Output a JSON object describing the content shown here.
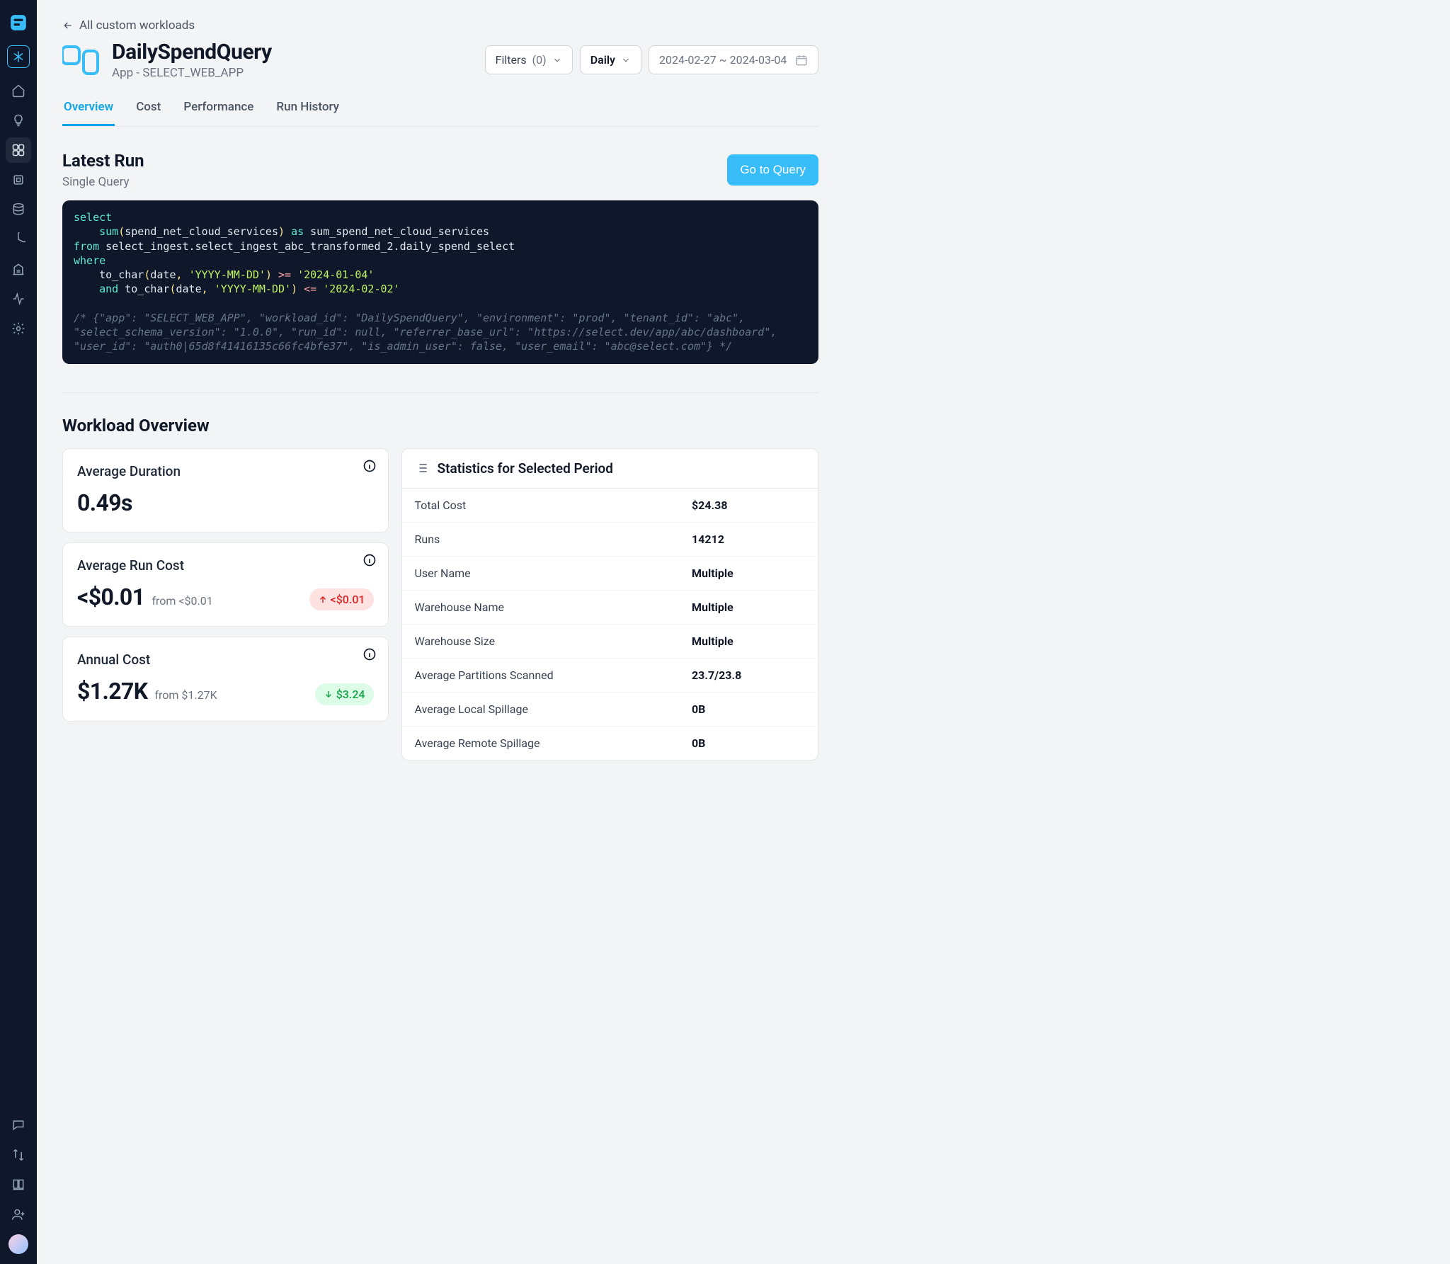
{
  "sidebar": {
    "icons": [
      "home-icon",
      "lightbulb-icon",
      "dashboard-icon",
      "chip-icon",
      "database-icon",
      "pie-chart-icon",
      "building-icon",
      "activity-icon",
      "gear-icon"
    ],
    "bottom_icons": [
      "chat-icon",
      "transfer-icon",
      "book-icon",
      "add-user-icon"
    ]
  },
  "back_link": "All custom workloads",
  "workload": {
    "title": "DailySpendQuery",
    "subtitle": "App - SELECT_WEB_APP"
  },
  "controls": {
    "filters_label": "Filters",
    "filters_count": "(0)",
    "period_label": "Daily",
    "date_range": "2024-02-27 ~ 2024-03-04"
  },
  "tabs": [
    "Overview",
    "Cost",
    "Performance",
    "Run History"
  ],
  "latest_run": {
    "title": "Latest Run",
    "subtitle": "Single Query",
    "go_button": "Go to Query",
    "sql": {
      "l1_kw": "select",
      "l2_fn": "sum",
      "l2_arg": "spend_net_cloud_services",
      "l2_as": "as",
      "l2_alias": "sum_spend_net_cloud_services",
      "l3_from": "from",
      "l3_table": "select_ingest.select_ingest_abc_transformed_2.daily_spend_select",
      "l4_where": "where",
      "l5_fn": "to_char",
      "l5_a1": "date",
      "l5_a2": "'YYYY-MM-DD'",
      "l5_op": ">=",
      "l5_v": "'2024-01-04'",
      "l6_and": "and",
      "l6_fn": "to_char",
      "l6_a1": "date",
      "l6_a2": "'YYYY-MM-DD'",
      "l6_op": "<=",
      "l6_v": "'2024-02-02'",
      "comment": "/* {\"app\": \"SELECT_WEB_APP\", \"workload_id\": \"DailySpendQuery\", \"environment\": \"prod\", \"tenant_id\": \"abc\", \"select_schema_version\": \"1.0.0\", \"run_id\": null, \"referrer_base_url\": \"https://select.dev/app/abc/dashboard\", \"user_id\": \"auth0|65d8f41416135c66fc4bfe37\", \"is_admin_user\": false, \"user_email\": \"abc@select.com\"} */"
    }
  },
  "overview_title": "Workload Overview",
  "metrics": [
    {
      "label": "Average Duration",
      "value": "0.49s",
      "from": "",
      "delta": "",
      "delta_dir": ""
    },
    {
      "label": "Average Run Cost",
      "value": "<$0.01",
      "from": "from <$0.01",
      "delta": "<$0.01",
      "delta_dir": "up"
    },
    {
      "label": "Annual Cost",
      "value": "$1.27K",
      "from": "from $1.27K",
      "delta": "$3.24",
      "delta_dir": "down"
    }
  ],
  "stats": {
    "title": "Statistics for Selected Period",
    "rows": [
      {
        "label": "Total Cost",
        "value": "$24.38"
      },
      {
        "label": "Runs",
        "value": "14212"
      },
      {
        "label": "User Name",
        "value": "Multiple"
      },
      {
        "label": "Warehouse Name",
        "value": "Multiple"
      },
      {
        "label": "Warehouse Size",
        "value": "Multiple"
      },
      {
        "label": "Average Partitions Scanned",
        "value": "23.7/23.8"
      },
      {
        "label": "Average Local Spillage",
        "value": "0B"
      },
      {
        "label": "Average Remote Spillage",
        "value": "0B"
      }
    ]
  }
}
